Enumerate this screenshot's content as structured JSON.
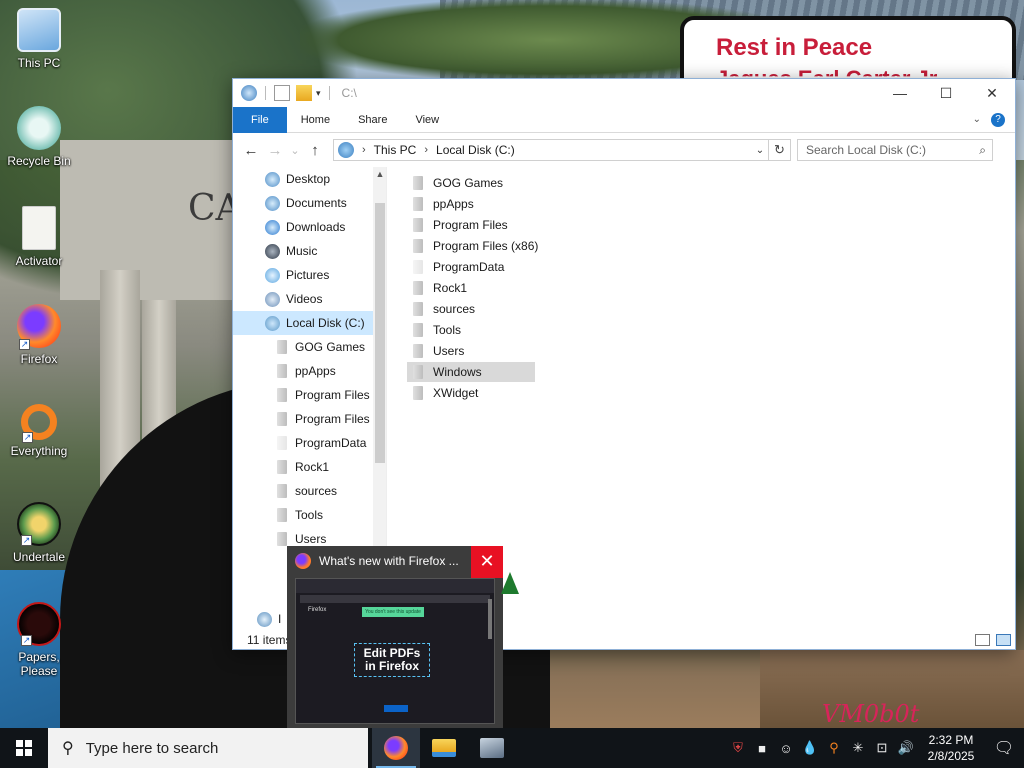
{
  "wallpaper": {
    "sign_line1": "Rest in Peace",
    "sign_line2": "Jaques Earl Carter Jr.",
    "building_text": "CA",
    "signature": "VM0b0t"
  },
  "desktop_icons": [
    {
      "label": "This PC",
      "icon": "computer-icon"
    },
    {
      "label": "Recycle Bin",
      "icon": "recycle-bin-icon"
    },
    {
      "label": "Activator",
      "icon": "document-icon"
    },
    {
      "label": "Firefox",
      "icon": "firefox-icon"
    },
    {
      "label": "Everything",
      "icon": "everything-search-icon"
    },
    {
      "label": "Undertale",
      "icon": "undertale-icon"
    },
    {
      "label": "Papers, Please",
      "icon": "papers-please-icon"
    }
  ],
  "explorer": {
    "title": "C:\\",
    "controls": {
      "minimize": "—",
      "maximize": "☐",
      "close": "✕"
    },
    "ribbon_tabs": [
      "File",
      "Home",
      "Share",
      "View"
    ],
    "nav": {
      "back": "←",
      "forward": "→",
      "recent": "⌄",
      "up": "↑"
    },
    "address": {
      "segments": [
        "This PC",
        "Local Disk (C:)"
      ],
      "separator": "›"
    },
    "search_placeholder": "Search Local Disk (C:)",
    "nav_pane": [
      {
        "label": "Desktop",
        "icon": "desktop-icon"
      },
      {
        "label": "Documents",
        "icon": "documents-icon"
      },
      {
        "label": "Downloads",
        "icon": "downloads-icon"
      },
      {
        "label": "Music",
        "icon": "music-icon"
      },
      {
        "label": "Pictures",
        "icon": "pictures-icon"
      },
      {
        "label": "Videos",
        "icon": "videos-icon"
      },
      {
        "label": "Local Disk (C:)",
        "icon": "drive-icon",
        "selected": true
      },
      {
        "label": "GOG Games",
        "icon": "folder-icon"
      },
      {
        "label": "ppApps",
        "icon": "folder-icon"
      },
      {
        "label": "Program Files",
        "icon": "folder-icon"
      },
      {
        "label": "Program Files (",
        "icon": "folder-icon"
      },
      {
        "label": "ProgramData",
        "icon": "folder-icon"
      },
      {
        "label": "Rock1",
        "icon": "folder-icon"
      },
      {
        "label": "sources",
        "icon": "folder-icon"
      },
      {
        "label": "Tools",
        "icon": "folder-icon"
      },
      {
        "label": "Users",
        "icon": "folder-icon"
      },
      {
        "label": "I",
        "icon": "network-icon"
      }
    ],
    "files": [
      {
        "name": "GOG Games"
      },
      {
        "name": "ppApps"
      },
      {
        "name": "Program Files"
      },
      {
        "name": "Program Files (x86)"
      },
      {
        "name": "ProgramData"
      },
      {
        "name": "Rock1"
      },
      {
        "name": "sources"
      },
      {
        "name": "Tools"
      },
      {
        "name": "Users"
      },
      {
        "name": "Windows",
        "selected": true
      },
      {
        "name": "XWidget"
      }
    ],
    "status": "11 items"
  },
  "firefox_preview": {
    "title": "What's new with Firefox ...",
    "close": "✕",
    "page_logo": "Firefox",
    "page_cta": "You don't see this update",
    "page_heading_line1": "Edit PDFs",
    "page_heading_line2": "in Firefox"
  },
  "taskbar": {
    "search_placeholder": "Type here to search",
    "apps": [
      "firefox-icon",
      "file-explorer-icon",
      "settings-app-icon"
    ],
    "tray_icons": [
      "antivirus-icon",
      "stop-icon",
      "people-icon",
      "droplet-icon",
      "everything-tray-icon",
      "asterisk-icon",
      "network-icon",
      "volume-icon"
    ],
    "time": "2:32 PM",
    "date": "2/8/2025"
  }
}
